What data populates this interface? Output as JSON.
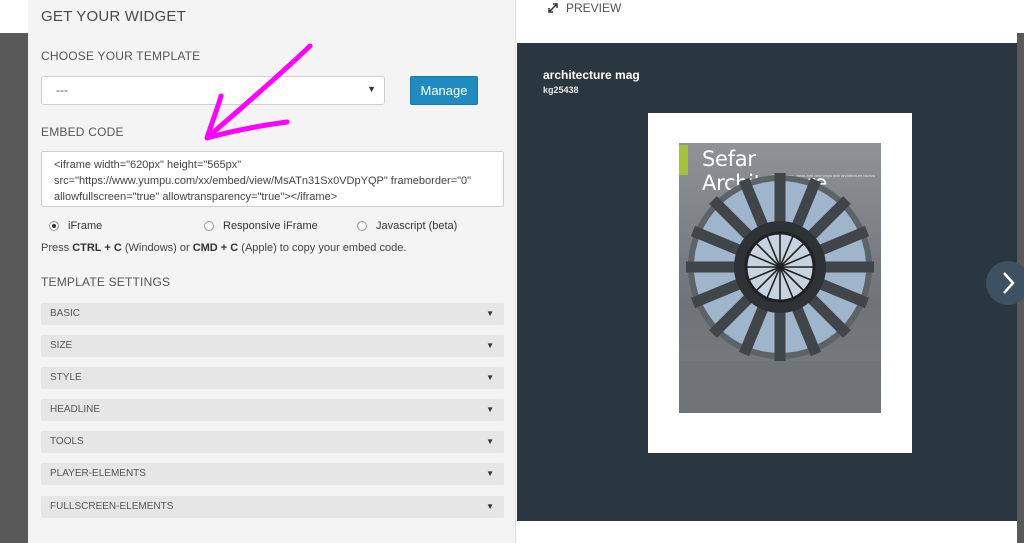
{
  "panel": {
    "title": "GET YOUR WIDGET",
    "template_section": "CHOOSE YOUR TEMPLATE",
    "template_select_value": "---",
    "manage_button": "Manage",
    "embed_section": "EMBED CODE",
    "embed_code": "<iframe width=\"620px\" height=\"565px\" src=\"https://www.yumpu.com/xx/embed/view/MsATn31Sx0VDpYQP\" frameborder=\"0\" allowfullscreen=\"true\"  allowtransparency=\"true\"></iframe>",
    "embed_options": [
      {
        "label": "iFrame",
        "selected": true
      },
      {
        "label": "Responsive iFrame",
        "selected": false
      },
      {
        "label": "Javascript (beta)",
        "selected": false
      }
    ],
    "hint": {
      "press": "Press ",
      "ctrl_c": "CTRL + C",
      "windows": " (Windows) or ",
      "cmd_c": "CMD + C",
      "rest": " (Apple) to copy your embed code."
    },
    "settings_section": "TEMPLATE SETTINGS",
    "settings": [
      "BASIC",
      "SIZE",
      "STYLE",
      "HEADLINE",
      "TOOLS",
      "PLAYER-ELEMENTS",
      "FULLSCREEN-ELEMENTS"
    ]
  },
  "preview": {
    "label": "PREVIEW",
    "doc_title": "architecture mag",
    "doc_user": "kg25438",
    "cover_title": "Sefar Architecture",
    "cover_subtitle": "Experiences, ideas and new ways with architecture fabrics"
  },
  "colors": {
    "accent_button": "#1e8cbe",
    "viewer_bg": "#2a3640",
    "annotation_arrow": "#ff00ff",
    "cover_accent": "#a7c23a"
  }
}
